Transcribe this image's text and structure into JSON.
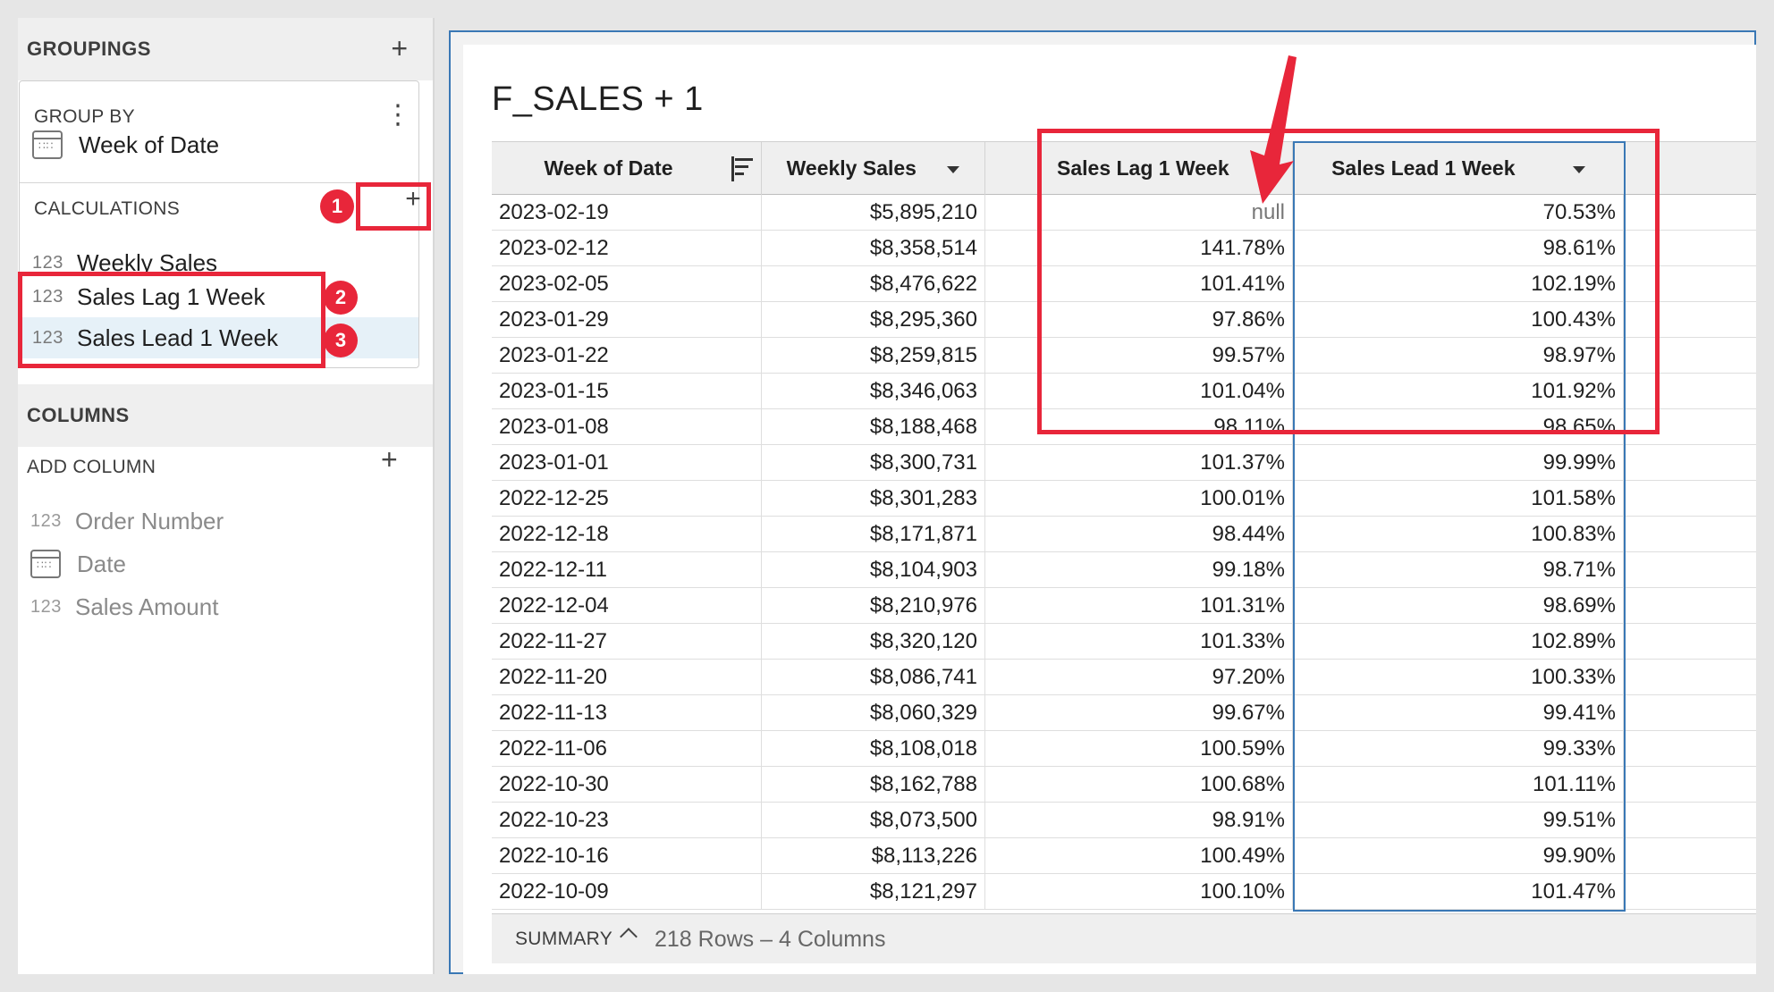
{
  "groupings": {
    "title": "GROUPINGS",
    "add_symbol": "+",
    "group_by_label": "GROUP BY",
    "menu_symbol": "⋮",
    "group_by_item": "Week of Date",
    "calculations_label": "CALCULATIONS",
    "calculations_add_symbol": "+",
    "calculations": [
      {
        "type": "123",
        "label": "Weekly Sales"
      },
      {
        "type": "123",
        "label": "Sales Lag 1 Week"
      },
      {
        "type": "123",
        "label": "Sales Lead 1 Week"
      }
    ]
  },
  "columns": {
    "title": "COLUMNS",
    "add_column_label": "ADD COLUMN",
    "add_symbol": "+",
    "items": [
      {
        "type": "123",
        "label": "Order Number"
      },
      {
        "type": "calendar",
        "label": "Date"
      },
      {
        "type": "123",
        "label": "Sales Amount"
      }
    ]
  },
  "badges": [
    "1",
    "2",
    "3"
  ],
  "table": {
    "title": "F_SALES + 1",
    "headers": [
      "Week of Date",
      "Weekly Sales",
      "Sales Lag 1 Week",
      "Sales Lead 1 Week"
    ],
    "rows": [
      [
        "2023-02-19",
        "$5,895,210",
        "null",
        "70.53%"
      ],
      [
        "2023-02-12",
        "$8,358,514",
        "141.78%",
        "98.61%"
      ],
      [
        "2023-02-05",
        "$8,476,622",
        "101.41%",
        "102.19%"
      ],
      [
        "2023-01-29",
        "$8,295,360",
        "97.86%",
        "100.43%"
      ],
      [
        "2023-01-22",
        "$8,259,815",
        "99.57%",
        "98.97%"
      ],
      [
        "2023-01-15",
        "$8,346,063",
        "101.04%",
        "101.92%"
      ],
      [
        "2023-01-08",
        "$8,188,468",
        "98.11%",
        "98.65%"
      ],
      [
        "2023-01-01",
        "$8,300,731",
        "101.37%",
        "99.99%"
      ],
      [
        "2022-12-25",
        "$8,301,283",
        "100.01%",
        "101.58%"
      ],
      [
        "2022-12-18",
        "$8,171,871",
        "98.44%",
        "100.83%"
      ],
      [
        "2022-12-11",
        "$8,104,903",
        "99.18%",
        "98.71%"
      ],
      [
        "2022-12-04",
        "$8,210,976",
        "101.31%",
        "98.69%"
      ],
      [
        "2022-11-27",
        "$8,320,120",
        "101.33%",
        "102.89%"
      ],
      [
        "2022-11-20",
        "$8,086,741",
        "97.20%",
        "100.33%"
      ],
      [
        "2022-11-13",
        "$8,060,329",
        "99.67%",
        "99.41%"
      ],
      [
        "2022-11-06",
        "$8,108,018",
        "100.59%",
        "99.33%"
      ],
      [
        "2022-10-30",
        "$8,162,788",
        "100.68%",
        "101.11%"
      ],
      [
        "2022-10-23",
        "$8,073,500",
        "98.91%",
        "99.51%"
      ],
      [
        "2022-10-16",
        "$8,113,226",
        "100.49%",
        "99.90%"
      ],
      [
        "2022-10-09",
        "$8,121,297",
        "100.10%",
        "101.47%"
      ]
    ]
  },
  "summary": {
    "label": "SUMMARY",
    "info": "218 Rows – 4 Columns"
  },
  "colors": {
    "annotation_red": "#e8263a",
    "selection_blue": "#3a78b5",
    "selected_row_bg": "#e6f1f8"
  }
}
